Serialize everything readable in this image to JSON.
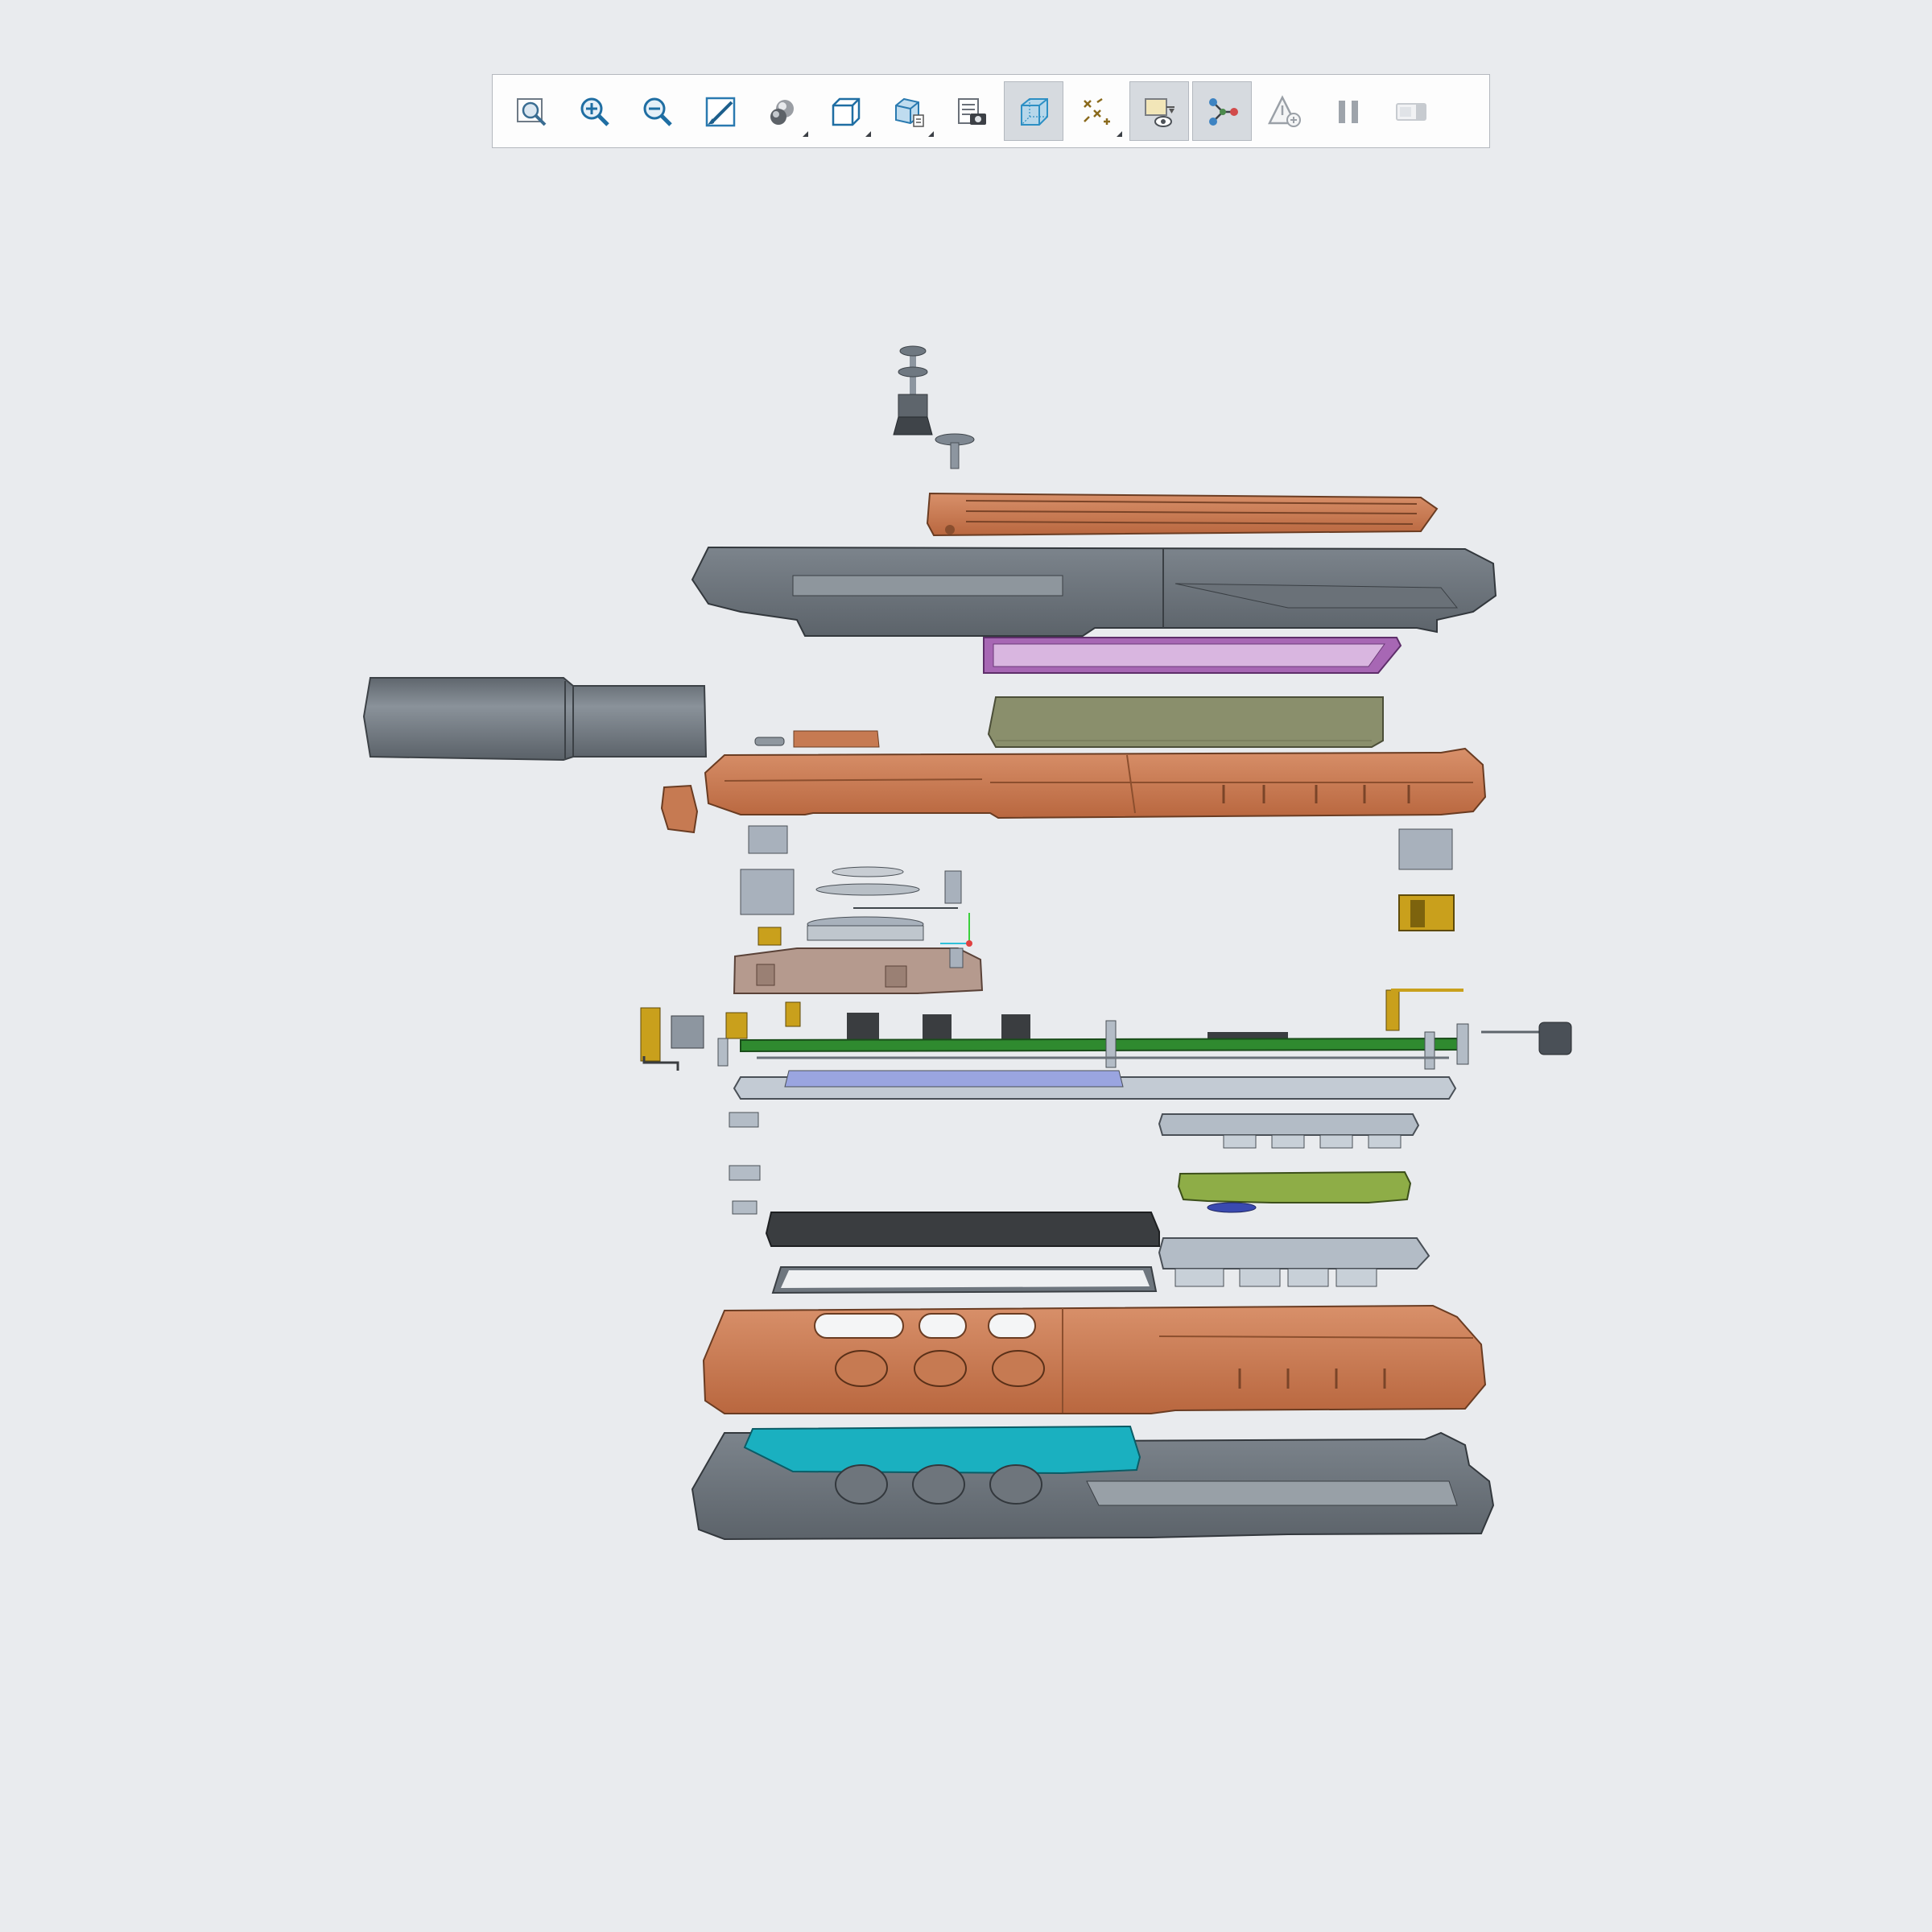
{
  "app": {
    "background": "#e9ebee"
  },
  "toolbar": {
    "buttons": [
      {
        "icon": "zoom-fit-icon",
        "active": false,
        "dropdown": false
      },
      {
        "icon": "zoom-in-icon",
        "active": false,
        "dropdown": false
      },
      {
        "icon": "zoom-out-icon",
        "active": false,
        "dropdown": false
      },
      {
        "icon": "view-orientation-icon",
        "active": false,
        "dropdown": false
      },
      {
        "icon": "display-style-icon",
        "active": false,
        "dropdown": true
      },
      {
        "icon": "standard-views-icon",
        "active": false,
        "dropdown": true
      },
      {
        "icon": "section-view-icon",
        "active": false,
        "dropdown": true
      },
      {
        "icon": "snapshot-icon",
        "active": false,
        "dropdown": false
      },
      {
        "icon": "transparent-view-icon",
        "active": true,
        "dropdown": false
      },
      {
        "icon": "explode-icon",
        "active": false,
        "dropdown": true
      },
      {
        "icon": "show-hide-icon",
        "active": true,
        "dropdown": false
      },
      {
        "icon": "assembly-structure-icon",
        "active": true,
        "dropdown": false
      },
      {
        "icon": "annotation-icon",
        "active": false,
        "dropdown": false
      },
      {
        "icon": "pause-icon",
        "active": false,
        "dropdown": false
      },
      {
        "icon": "animation-icon",
        "active": false,
        "dropdown": false
      }
    ]
  },
  "model": {
    "name": "exploded-assembly",
    "colors": {
      "copper": "#c8774f",
      "dark_gray": "#6b737b",
      "light_gray": "#a8b1bc",
      "purple": "#9b5aa8",
      "olive": "#8a8f6c",
      "pcb_green": "#2f8a2f",
      "yellow_green": "#8ead47",
      "gold": "#c9a01c",
      "teal": "#1ab0c0",
      "tan": "#b59a8e",
      "black": "#3a3d40"
    }
  }
}
